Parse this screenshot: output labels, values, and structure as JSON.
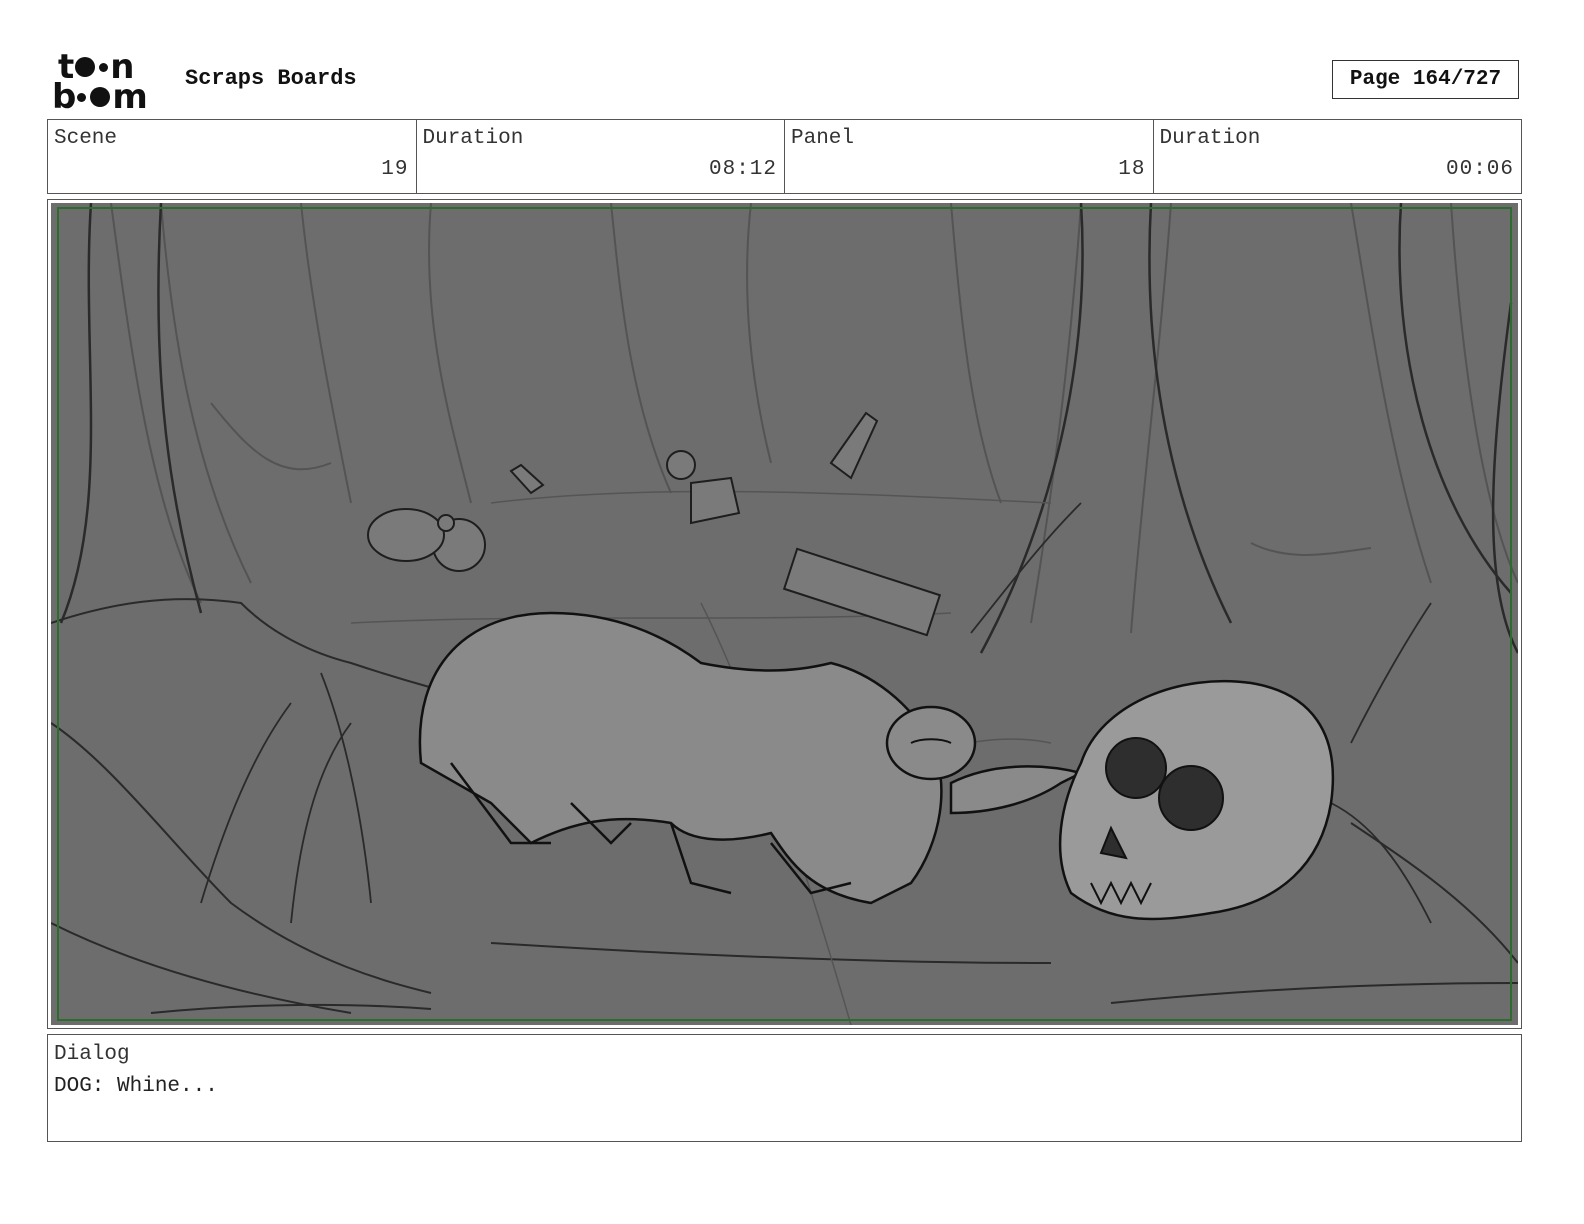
{
  "header": {
    "logo_top": "t",
    "logo_top_end": "n",
    "logo_bottom_start": "b",
    "logo_bottom_end": "m",
    "title": "Scraps Boards",
    "page": "Page 164/727"
  },
  "info": {
    "scene_label": "Scene",
    "scene_value": "19",
    "scene_duration_label": "Duration",
    "scene_duration_value": "08:12",
    "panel_label": "Panel",
    "panel_value": "18",
    "panel_duration_label": "Duration",
    "panel_duration_value": "00:06"
  },
  "dialog": {
    "label": "Dialog",
    "text": "DOG: Whine..."
  },
  "colors": {
    "panel_bg": "#6d6d6d",
    "safe_frame": "#2e6b2e",
    "sketch_line": "#1e1e1e"
  }
}
